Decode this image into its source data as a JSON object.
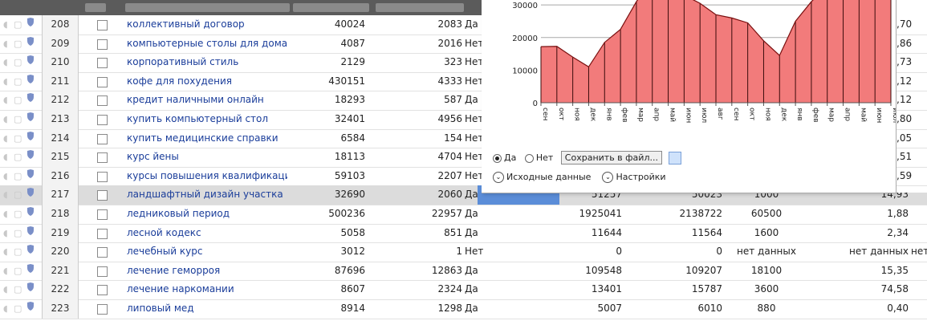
{
  "rows": [
    {
      "num": "208",
      "kw": "коллективный договор",
      "v1": "40024",
      "v2": "2083",
      "yn": "Да",
      "right": ",70"
    },
    {
      "num": "209",
      "kw": "компьютерные столы для дома",
      "v1": "4087",
      "v2": "2016",
      "yn": "Нет",
      "right": ",86"
    },
    {
      "num": "210",
      "kw": "корпоративный стиль",
      "v1": "2129",
      "v2": "323",
      "yn": "Нет",
      "right": ",73"
    },
    {
      "num": "211",
      "kw": "кофе для похудения",
      "v1": "430151",
      "v2": "4333",
      "yn": "Нет",
      "right": ",12"
    },
    {
      "num": "212",
      "kw": "кредит наличными онлайн",
      "v1": "18293",
      "v2": "587",
      "yn": "Да",
      "right": ",12"
    },
    {
      "num": "213",
      "kw": "купить компьютерный стол",
      "v1": "32401",
      "v2": "4956",
      "yn": "Нет",
      "right": ",80"
    },
    {
      "num": "214",
      "kw": "купить медицинские справки",
      "v1": "6584",
      "v2": "154",
      "yn": "Нет",
      "right": ",05"
    },
    {
      "num": "215",
      "kw": "курс йены",
      "v1": "18113",
      "v2": "4704",
      "yn": "Нет",
      "right": ",51"
    },
    {
      "num": "216",
      "kw": "курсы повышения квалификации",
      "v1": "59103",
      "v2": "2207",
      "yn": "Нет",
      "right": ",59"
    },
    {
      "num": "217",
      "kw": "ландшафтный дизайн участка",
      "v1": "32690",
      "v2": "2060",
      "yn": "Да",
      "v3": "51257",
      "v4": "50023",
      "v5": "1000",
      "v6": "14,93",
      "v7": "",
      "sel": true
    },
    {
      "num": "218",
      "kw": "ледниковый период",
      "v1": "500236",
      "v2": "22957",
      "yn": "Да",
      "v3": "1925041",
      "v4": "2138722",
      "v5": "60500",
      "v6": "1,88",
      "v7": ""
    },
    {
      "num": "219",
      "kw": "лесной кодекс",
      "v1": "5058",
      "v2": "851",
      "yn": "Да",
      "v3": "11644",
      "v4": "11564",
      "v5": "1600",
      "v6": "2,34",
      "v7": ""
    },
    {
      "num": "220",
      "kw": "лечебный курс",
      "v1": "3012",
      "v2": "1",
      "yn": "Нет",
      "v3": "0",
      "v4": "0",
      "v5": "нет данных",
      "v6": "нет данных",
      "v7": "нет"
    },
    {
      "num": "221",
      "kw": "лечение геморроя",
      "v1": "87696",
      "v2": "12863",
      "yn": "Да",
      "v3": "109548",
      "v4": "109207",
      "v5": "18100",
      "v6": "15,35",
      "v7": ""
    },
    {
      "num": "222",
      "kw": "лечение наркомании",
      "v1": "8607",
      "v2": "2324",
      "yn": "Да",
      "v3": "13401",
      "v4": "15787",
      "v5": "3600",
      "v6": "74,58",
      "v7": ""
    },
    {
      "num": "223",
      "kw": "липовый мед",
      "v1": "8914",
      "v2": "1298",
      "yn": "Да",
      "v3": "5007",
      "v4": "6010",
      "v5": "880",
      "v6": "0,40",
      "v7": ""
    }
  ],
  "popup": {
    "radio_yes": "Да",
    "radio_no": "Нет",
    "save_button": "Сохранить в файл...",
    "source_data": "Исходные данные",
    "settings": "Настройки"
  },
  "chart_data": {
    "type": "area",
    "categories": [
      "сен",
      "окт",
      "ноя",
      "дек",
      "янв",
      "фев",
      "мар",
      "апр",
      "май",
      "июн",
      "июл",
      "авг",
      "сен",
      "окт",
      "ноя",
      "дек",
      "янв",
      "фев",
      "мар",
      "апр",
      "май",
      "июн",
      "июл"
    ],
    "values": [
      17200,
      17300,
      14000,
      11000,
      18500,
      22500,
      31000,
      38000,
      36000,
      33000,
      30500,
      27000,
      26000,
      24500,
      19000,
      14500,
      25000,
      31000,
      36000,
      38000,
      37000,
      35000,
      33000
    ],
    "yticks": [
      "0",
      "10000",
      "20000",
      "30000"
    ],
    "ylim": [
      0,
      32000
    ],
    "fill": "#f27b7b",
    "stroke": "#7a1010"
  }
}
